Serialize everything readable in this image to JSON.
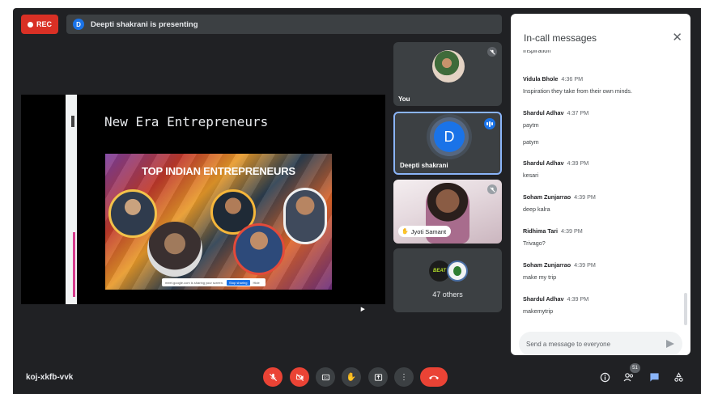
{
  "header": {
    "rec_label": "REC",
    "presenter_initial": "D",
    "presenting_text": "Deepti shakrani is presenting"
  },
  "presentation": {
    "slide_title": "New Era Entrepreneurs",
    "slide_heading": "TOP INDIAN ENTREPRENEURS",
    "share_bar_text": "meet.google.com is sharing your screen.",
    "share_bar_button": "Stop sharing",
    "share_bar_hide": "Hide"
  },
  "participants": [
    {
      "name": "You",
      "muted": true
    },
    {
      "name": "Deepti shakrani",
      "initial": "D",
      "speaking": true,
      "color": "#1a73e8"
    },
    {
      "name": "Jyoti Samant",
      "hand_raised": true
    },
    {
      "label": "47 others",
      "avatar_text": "BEAT"
    }
  ],
  "chat": {
    "title": "In-call messages",
    "close_icon": "close-icon",
    "truncated_top": "Inspiration",
    "messages": [
      {
        "sender": "Vidula Bhole",
        "time": "4:36 PM",
        "lines": [
          "Inspiration they take from their own minds."
        ]
      },
      {
        "sender": "Shardul Adhav",
        "time": "4:37 PM",
        "lines": [
          "paytm",
          "patym"
        ]
      },
      {
        "sender": "Shardul Adhav",
        "time": "4:39 PM",
        "lines": [
          "kesari"
        ]
      },
      {
        "sender": "Soham Zunjarrao",
        "time": "4:39 PM",
        "lines": [
          "deep kalra"
        ]
      },
      {
        "sender": "Ridhima Tari",
        "time": "4:39 PM",
        "lines": [
          "Trivago?"
        ]
      },
      {
        "sender": "Soham Zunjarrao",
        "time": "4:39 PM",
        "lines": [
          "make my trip"
        ]
      },
      {
        "sender": "Shardul Adhav",
        "time": "4:39 PM",
        "lines": [
          "makemytrip"
        ]
      }
    ],
    "input_placeholder": "Send a message to everyone"
  },
  "bottom_bar": {
    "meeting_code": "koj-xkfb-vvk",
    "people_count": "51",
    "controls": [
      "mic-off-icon",
      "camera-off-icon",
      "captions-icon",
      "raise-hand-icon",
      "present-icon",
      "more-options-icon",
      "leave-call-icon"
    ],
    "right_icons": [
      "info-icon",
      "people-icon",
      "chat-icon",
      "activities-icon"
    ]
  },
  "colors": {
    "background": "#202124",
    "tile": "#3c4043",
    "accent": "#1a73e8",
    "danger": "#ea4335",
    "active_border": "#8ab4f8"
  }
}
